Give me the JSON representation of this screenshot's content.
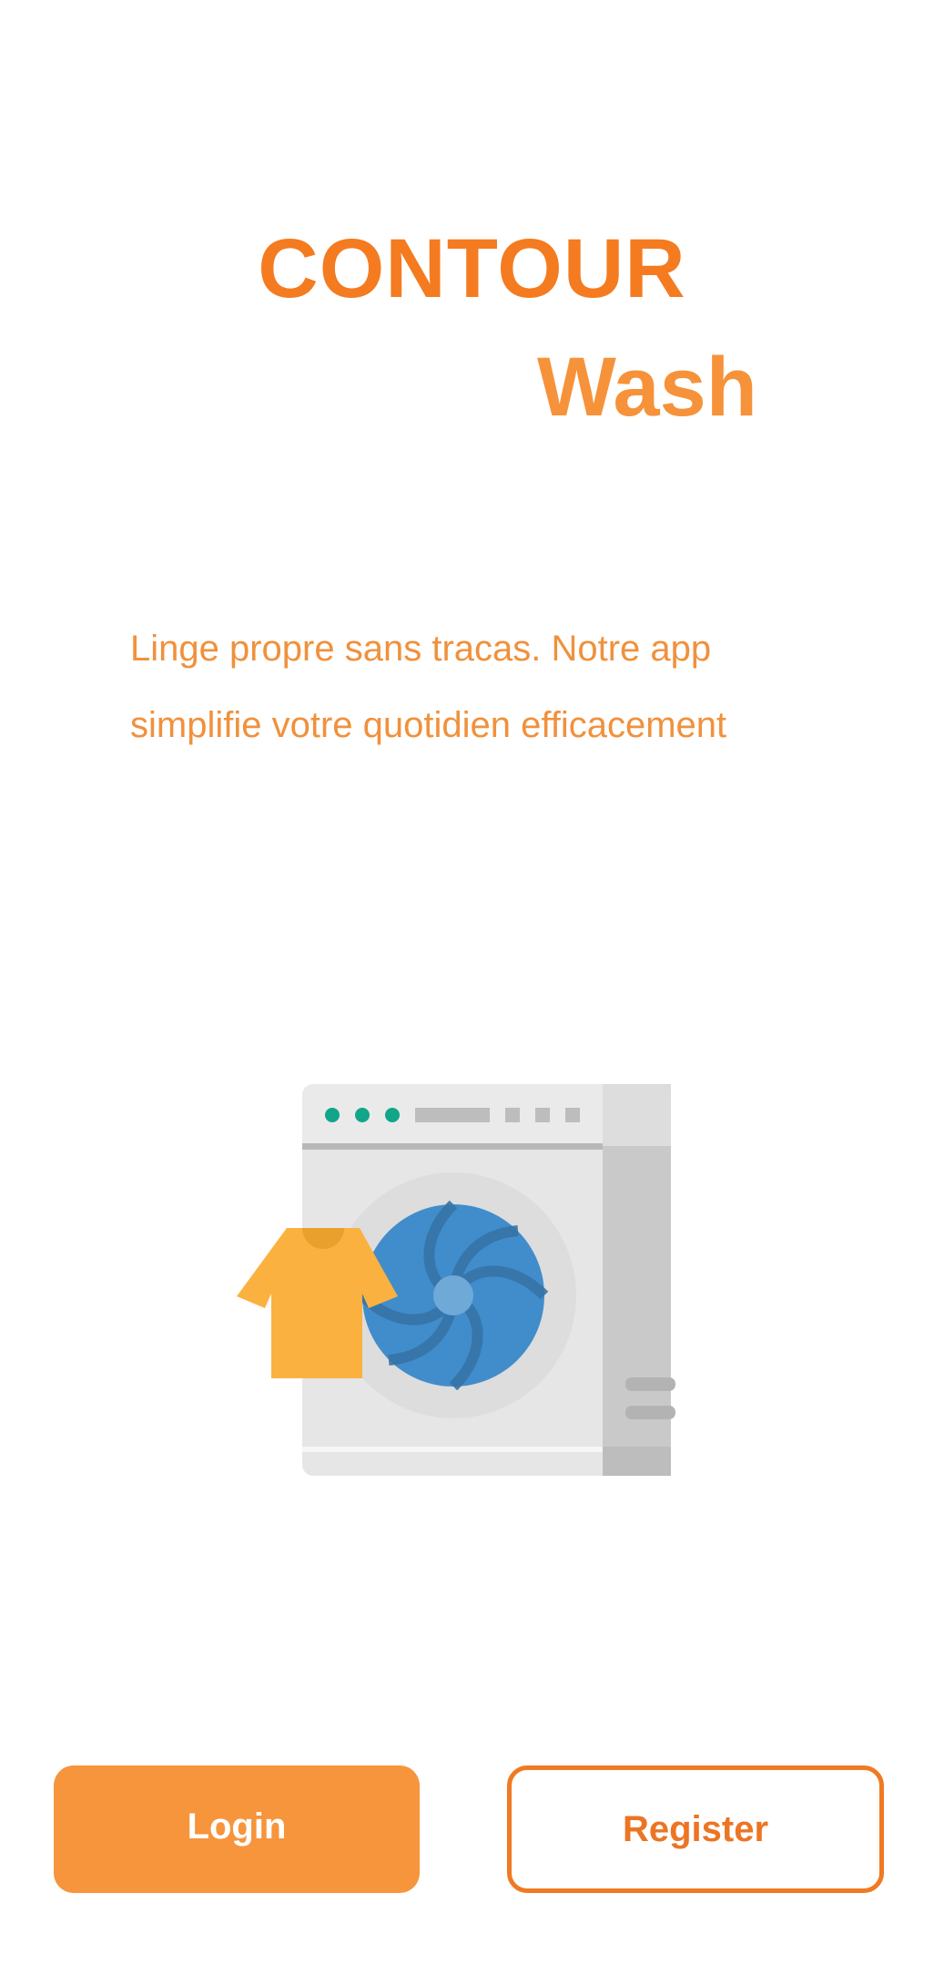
{
  "brand": {
    "title": "CONTOUR",
    "subtitle": "Wash"
  },
  "tagline": {
    "line1": "Linge propre sans tracas. Notre app",
    "line2": "simplifie votre quotidien efficacement"
  },
  "illustration": {
    "name": "washing-machine-with-shirt",
    "colors": {
      "machine_body": "#E6E6E6",
      "machine_side": "#C9C9C9",
      "drum": "#418DCB",
      "indicator_lights": "#12A58A",
      "shirt": "#FBB13F"
    }
  },
  "actions": {
    "login_label": "Login",
    "register_label": "Register"
  },
  "colors": {
    "brand_orange": "#F47B20",
    "brand_orange_light": "#F6923A",
    "button_fill": "#F7953C"
  }
}
